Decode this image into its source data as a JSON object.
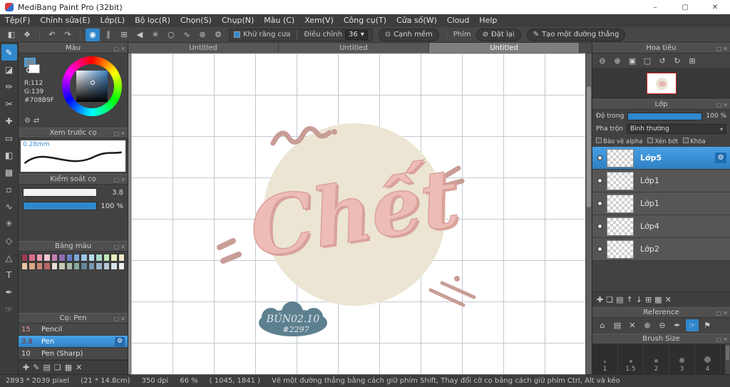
{
  "window": {
    "title": "MediBang Paint Pro (32bit)"
  },
  "icons": {
    "minimize": "–",
    "maximize": "▢",
    "close": "✕",
    "undo": "↶",
    "redo": "↷",
    "bucket": "◧",
    "palette": "❖",
    "snap": [
      "◉",
      "∥",
      "⊞",
      "◀",
      "✳",
      "○",
      "∿",
      "⊛",
      "⚙"
    ],
    "antialias": "▞",
    "soft_edge": "⊙",
    "reset": "⊘",
    "line": "✎",
    "caret": "▾",
    "collapse": "▢",
    "close_panel": "✕",
    "tools": [
      "✎",
      "◪",
      "✏",
      "✂",
      "✚",
      "▭",
      "◧",
      "▩",
      "▫",
      "∿",
      "✳",
      "◇",
      "△",
      "T",
      "✒",
      "☞"
    ],
    "color_settings": "⚙",
    "color_swap": "⇄",
    "brush_bottom": [
      "✚",
      "✎",
      "▤",
      "❏",
      "▦",
      "✕"
    ],
    "navigator": [
      "⊖",
      "⊕",
      "▣",
      "▢",
      "↺",
      "↻",
      "⊞"
    ],
    "layer_gear": "⚙",
    "layer_tools": [
      "✚",
      "❏",
      "▤",
      "↑",
      "↓",
      "⊞",
      "▦",
      "✕"
    ],
    "reference": [
      "⌂",
      "▤",
      "✕",
      "⊕",
      "⊖",
      "✒",
      "☞",
      "⚑"
    ]
  },
  "menu": {
    "items": [
      "Tệp(F)",
      "Chỉnh sửa(E)",
      "Lớp(L)",
      "Bộ lọc(R)",
      "Chọn(S)",
      "Chụp(N)",
      "Màu (C)",
      "Xem(V)",
      "Công cụ(T)",
      "Cửa sổ(W)",
      "Cloud",
      "Help"
    ]
  },
  "toolbar": {
    "antialias": "Khử răng cưa",
    "adjust": "Điều chỉnh",
    "adjust_value": "36",
    "soft_edge": "Cạnh mềm",
    "key": "Phím",
    "reset": "Đặt lại",
    "make_line": "Tạo một đường thẳng"
  },
  "color_panel": {
    "title": "Màu",
    "r": "R:112",
    "g": "G:139",
    "hex": "#708B9F"
  },
  "brush_preview": {
    "title": "Xem trước cọ",
    "size": "0.28mm"
  },
  "brush_control": {
    "title": "Kiểm soát cọ",
    "size_value": "3.8",
    "opacity_value": "100 %"
  },
  "palette": {
    "title": "Bảng màu",
    "colors": [
      "#9e3b50",
      "#d96d8a",
      "#e89bb0",
      "#f2c4cf",
      "#c77fb4",
      "#8f6bb3",
      "#6b7fc7",
      "#7fa8d9",
      "#9cc8e8",
      "#b8e0ea",
      "#a8d8c8",
      "#c5e8b8",
      "#e8eec0",
      "#f5e6c8",
      "#e8c8a8",
      "#d9a888",
      "#c88878",
      "#b86868",
      "#e8e0d8",
      "#c8c8b8",
      "#a8b8a8",
      "#88a8a0",
      "#688898",
      "#7898b0",
      "#98b0c8",
      "#b8c8d8",
      "#d8e0e8",
      "#f0f0f0"
    ]
  },
  "brushes": {
    "title": "Cọ: Pen",
    "items": [
      {
        "size": "15",
        "name": "Pencil"
      },
      {
        "size": "3.8",
        "name": "Pen"
      },
      {
        "size": "10",
        "name": "Pen (Sharp)"
      }
    ]
  },
  "tabs": {
    "items": [
      "Untitled",
      "Untitled",
      "Untitled"
    ]
  },
  "navigator": {
    "title": "Hoa tiêu"
  },
  "layers": {
    "title": "Lớp",
    "opacity_label": "Độ trong",
    "opacity_value": "100 %",
    "blend_label": "Pha trộn",
    "blend_value": "Bình thường",
    "protect_alpha": "Bảo vệ alpha",
    "clip": "Xén bớt",
    "lock": "Khóa",
    "items": [
      "Lớp5",
      "Lớp1",
      "Lớp1",
      "Lớp4",
      "Lớp2"
    ]
  },
  "reference": {
    "title": "Reference"
  },
  "brush_size": {
    "title": "Brush Size",
    "sizes": [
      "1",
      "1.5",
      "2",
      "3",
      "4"
    ]
  },
  "artwork": {
    "word": "Chết",
    "badge_line1": "BÚN02.10",
    "badge_line2": "#2297",
    "colors": {
      "circle": "#ece5d3",
      "word": "#eebcb6",
      "word_outline": "#d9a29b",
      "accent": "#c89d96",
      "badge": "#5d8090",
      "badge_text": "#e3eaee"
    }
  },
  "ui": {
    "accent": "#2f87cc",
    "slider_white": "#f2f2f2"
  },
  "status": {
    "size": "2893 * 2039 pixel",
    "dims": "(21 * 14.8cm)",
    "dpi": "350 dpi",
    "zoom": "66 %",
    "pos": "( 1045, 1841 )",
    "hint": "Vẽ một đường thẳng bằng cách giữ phím Shift, Thay đổi cỡ cọ bằng cách giữ phím Ctrl, Alt và kéo"
  }
}
